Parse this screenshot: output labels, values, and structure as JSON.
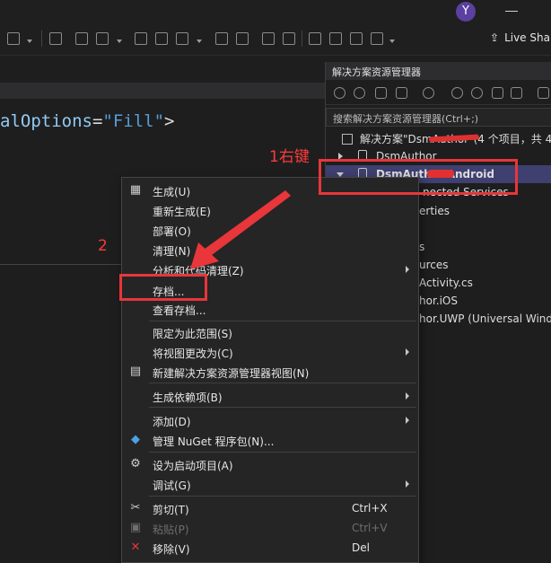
{
  "titlebar": {
    "avatar_initial": "Y"
  },
  "toolbar": {
    "live_share_label": "Live Sha"
  },
  "editor": {
    "code_attr": "alOptions",
    "code_eq": "=",
    "code_value": "\"Fill\"",
    "code_close": ">"
  },
  "solution_explorer": {
    "title": "解决方案资源管理器",
    "search_placeholder": "搜索解决方案资源管理器(Ctrl+;)",
    "rows": [
      {
        "label": "解决方案\"DsmAuthor\"(4 个项目，共 4"
      },
      {
        "label": "DsmAuthor"
      },
      {
        "label": "DsmAuthor.Android"
      },
      {
        "label": "nected Services"
      },
      {
        "label": "erties"
      },
      {
        "label": "s"
      },
      {
        "label": "urces"
      },
      {
        "label": "Activity.cs"
      },
      {
        "label": "hor.iOS"
      },
      {
        "label": "hor.UWP (Universal Windo"
      }
    ]
  },
  "context_menu": {
    "items": [
      {
        "label": "生成(U)",
        "icon": "build-icon"
      },
      {
        "label": "重新生成(E)"
      },
      {
        "label": "部署(O)"
      },
      {
        "label": "清理(N)"
      },
      {
        "label": "分析和代码清理(Z)",
        "submenu": true
      },
      {
        "label": "存档..."
      },
      {
        "label": "查看存档..."
      },
      {
        "label": "限定为此范围(S)"
      },
      {
        "label": "将视图更改为(C)",
        "submenu": true
      },
      {
        "label": "新建解决方案资源管理器视图(N)",
        "icon": "new-view-icon"
      },
      {
        "label": "生成依赖项(B)",
        "submenu": true
      },
      {
        "label": "添加(D)",
        "submenu": true
      },
      {
        "label": "管理 NuGet 程序包(N)...",
        "icon": "nuget-icon"
      },
      {
        "label": "设为启动项目(A)",
        "icon": "gear-icon"
      },
      {
        "label": "调试(G)",
        "submenu": true
      },
      {
        "label": "剪切(T)",
        "shortcut": "Ctrl+X",
        "icon": "scissors-icon"
      },
      {
        "label": "粘贴(P)",
        "shortcut": "Ctrl+V",
        "icon": "paste-icon",
        "disabled": true
      },
      {
        "label": "移除(V)",
        "shortcut": "Del",
        "icon": "remove-x-icon"
      }
    ]
  },
  "annotations": {
    "step1": "1右键",
    "step2": "2",
    "color": "#e8363a"
  },
  "colors": {
    "selection": "#3f3f70",
    "menu_bg": "#252526",
    "editor_bg": "#1e1e1e"
  }
}
